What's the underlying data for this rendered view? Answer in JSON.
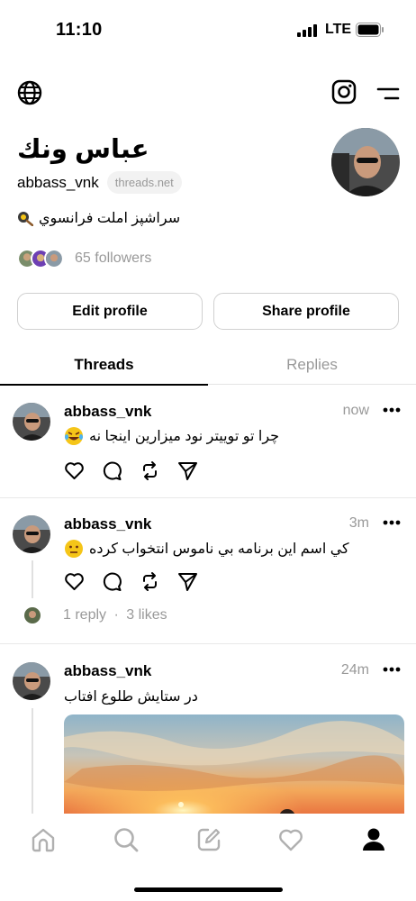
{
  "status_bar": {
    "time": "11:10",
    "network": "LTE"
  },
  "profile": {
    "name": "عباس ونك",
    "handle": "abbass_vnk",
    "domain": "threads.net",
    "bio": "سراشپز املت فرانسوي",
    "bio_icon": "frying-pan-emoji",
    "followers": "65 followers",
    "edit_label": "Edit profile",
    "share_label": "Share profile"
  },
  "tabs": [
    {
      "label": "Threads",
      "active": true
    },
    {
      "label": "Replies",
      "active": false
    }
  ],
  "posts": [
    {
      "user": "abbass_vnk",
      "time": "now",
      "text": "چرا تو تویيتر نود ميزارين اينجا نه",
      "emoji": "laughing-crying"
    },
    {
      "user": "abbass_vnk",
      "time": "3m",
      "text": "كي اسم اين برنامه بي ناموس انتخواب كرده",
      "emoji": "neutral-face",
      "replies": "1 reply",
      "likes": "3 likes",
      "separator": "·"
    },
    {
      "user": "abbass_vnk",
      "time": "24m",
      "text": "در ستايش طلوع افتاب",
      "image": "sunrise-photo"
    }
  ],
  "colors": {
    "accent": "#000000",
    "muted": "#999999",
    "divider": "#e5e5e5"
  },
  "nav": [
    "home-icon",
    "search-icon",
    "compose-icon",
    "heart-icon",
    "profile-icon"
  ]
}
